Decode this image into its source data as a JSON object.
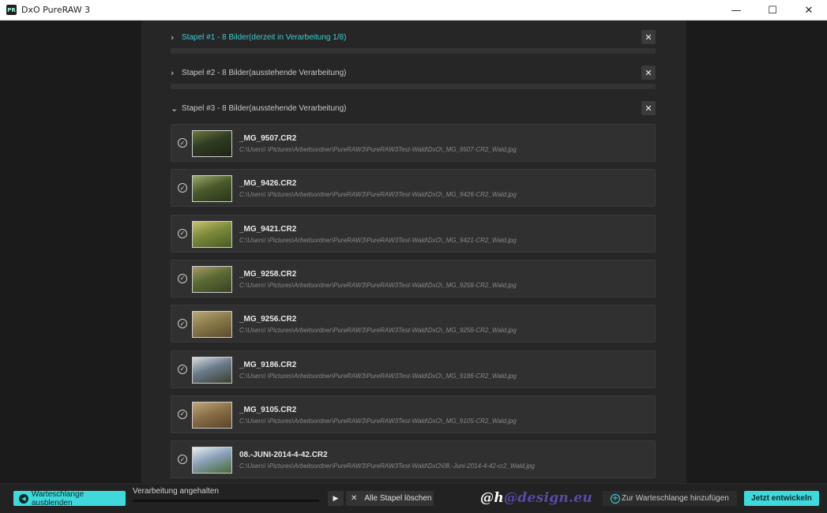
{
  "window": {
    "logo": "PR",
    "title": "DxO PureRAW 3",
    "minimize": "—",
    "maximize": "☐",
    "close": "✕"
  },
  "batches": [
    {
      "expanded": false,
      "active": true,
      "label": "Stapel #1 - 8 Bilder(derzeit in Verarbeitung 1/8)"
    },
    {
      "expanded": false,
      "active": false,
      "label": "Stapel #2 - 8 Bilder(ausstehende Verarbeitung)"
    },
    {
      "expanded": true,
      "active": false,
      "label": "Stapel #3 - 8 Bilder(ausstehende Verarbeitung)"
    }
  ],
  "items": [
    {
      "name": "_MG_9507.CR2",
      "path": "C:\\Users\\        \\Pictures\\Arbeitsordner\\PureRAW3\\PureRAW3Test-Wald\\DxO\\_MG_9507-CR2_Wald.jpg",
      "thumb_colors": [
        "#2f3b22",
        "#6b7a3a",
        "#1c2414"
      ]
    },
    {
      "name": "_MG_9426.CR2",
      "path": "C:\\Users\\        \\Pictures\\Arbeitsordner\\PureRAW3\\PureRAW3Test-Wald\\DxO\\_MG_9426-CR2_Wald.jpg",
      "thumb_colors": [
        "#4a5a2c",
        "#9aa86a",
        "#2a3418"
      ]
    },
    {
      "name": "_MG_9421.CR2",
      "path": "C:\\Users\\        \\Pictures\\Arbeitsordner\\PureRAW3\\PureRAW3Test-Wald\\DxO\\_MG_9421-CR2_Wald.jpg",
      "thumb_colors": [
        "#7a8a3a",
        "#c8c070",
        "#4a5a24"
      ]
    },
    {
      "name": "_MG_9258.CR2",
      "path": "C:\\Users\\        \\Pictures\\Arbeitsordner\\PureRAW3\\PureRAW3Test-Wald\\DxO\\_MG_9258-CR2_Wald.jpg",
      "thumb_colors": [
        "#5a6a34",
        "#a89a6a",
        "#3a4224"
      ]
    },
    {
      "name": "_MG_9256.CR2",
      "path": "C:\\Users\\        \\Pictures\\Arbeitsordner\\PureRAW3\\PureRAW3Test-Wald\\DxO\\_MG_9256-CR2_Wald.jpg",
      "thumb_colors": [
        "#8a7a4a",
        "#b8a878",
        "#5a4a2a"
      ]
    },
    {
      "name": "_MG_9186.CR2",
      "path": "C:\\Users\\        \\Pictures\\Arbeitsordner\\PureRAW3\\PureRAW3Test-Wald\\DxO\\_MG_9186-CR2_Wald.jpg",
      "thumb_colors": [
        "#6a7a8a",
        "#d8dce0",
        "#3a4030"
      ]
    },
    {
      "name": "_MG_9105.CR2",
      "path": "C:\\Users\\        \\Pictures\\Arbeitsordner\\PureRAW3\\PureRAW3Test-Wald\\DxO\\_MG_9105-CR2_Wald.jpg",
      "thumb_colors": [
        "#8a7048",
        "#c0a878",
        "#5a4428"
      ]
    },
    {
      "name": "08.-JUNI-2014-4-42.CR2",
      "path": "C:\\Users\\        \\Pictures\\Arbeitsordner\\PureRAW3\\PureRAW3Test-Wald\\DxO\\08.-Juni-2014-4-42-cr2_Wald.jpg",
      "thumb_colors": [
        "#8aa0b8",
        "#e8eef0",
        "#4a6a34"
      ]
    }
  ],
  "bottom": {
    "hide_queue": "Warteschlange ausblenden",
    "status": "Verarbeitung angehalten",
    "progress": 0,
    "clear_all": "Alle Stapel löschen",
    "watermark_a": "@",
    "watermark_b": "h",
    "watermark_c": "@design.eu",
    "add_to_queue": "Zur Warteschlange hinzufügen",
    "develop_now": "Jetzt entwickeln"
  },
  "colors": {
    "accent": "#3fd9dc",
    "active_batch": "#3ecbd0"
  }
}
